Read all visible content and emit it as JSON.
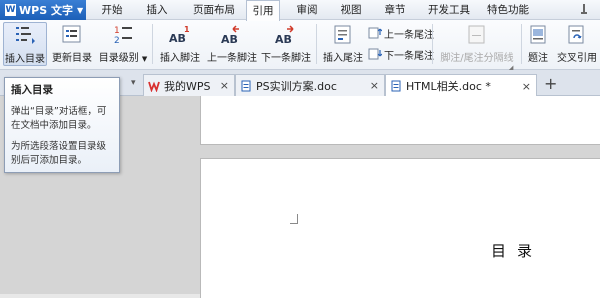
{
  "app": {
    "title": "WPS 文字",
    "logo": "W"
  },
  "menu": {
    "items": [
      "开始",
      "插入",
      "页面布局",
      "引用",
      "审阅",
      "视图",
      "章节",
      "开发工具",
      "特色功能"
    ],
    "active": "引用"
  },
  "ribbon": {
    "insert_toc": "插入目录",
    "update_toc": "更新目录",
    "toc_level": "目录级别",
    "insert_footnote": "插入脚注",
    "prev_footnote": "上一条脚注",
    "next_footnote": "下一条脚注",
    "insert_endnote": "插入尾注",
    "prev_endnote": "上一条尾注",
    "next_endnote": "下一条尾注",
    "footnote_separator": "脚注/尾注分隔线",
    "caption": "题注",
    "cross_reference": "交叉引用",
    "icon_text": {
      "toc": "1\n2",
      "ab": "AB",
      "sup1": "1"
    }
  },
  "tabs": [
    {
      "label": "我的WPS",
      "icon": "wps-logo-icon",
      "active": false,
      "close": "×"
    },
    {
      "label": "PS实训方案.doc",
      "icon": "doc-icon",
      "active": false,
      "close": "×"
    },
    {
      "label": "HTML相关.doc *",
      "icon": "doc-icon",
      "active": true,
      "close": "×"
    }
  ],
  "new_tab": "+",
  "tooltip": {
    "title": "插入目录",
    "line1": "弹出“目录”对话框，可在文档中添加目录。",
    "line2": "为所选段落设置目录级别后可添加目录。"
  },
  "document": {
    "heading": "目录"
  },
  "colors": {
    "accent": "#1c5fb8",
    "wps_red": "#d8302f",
    "icon_blue": "#2b63b5",
    "icon_red": "#d03a2a"
  }
}
